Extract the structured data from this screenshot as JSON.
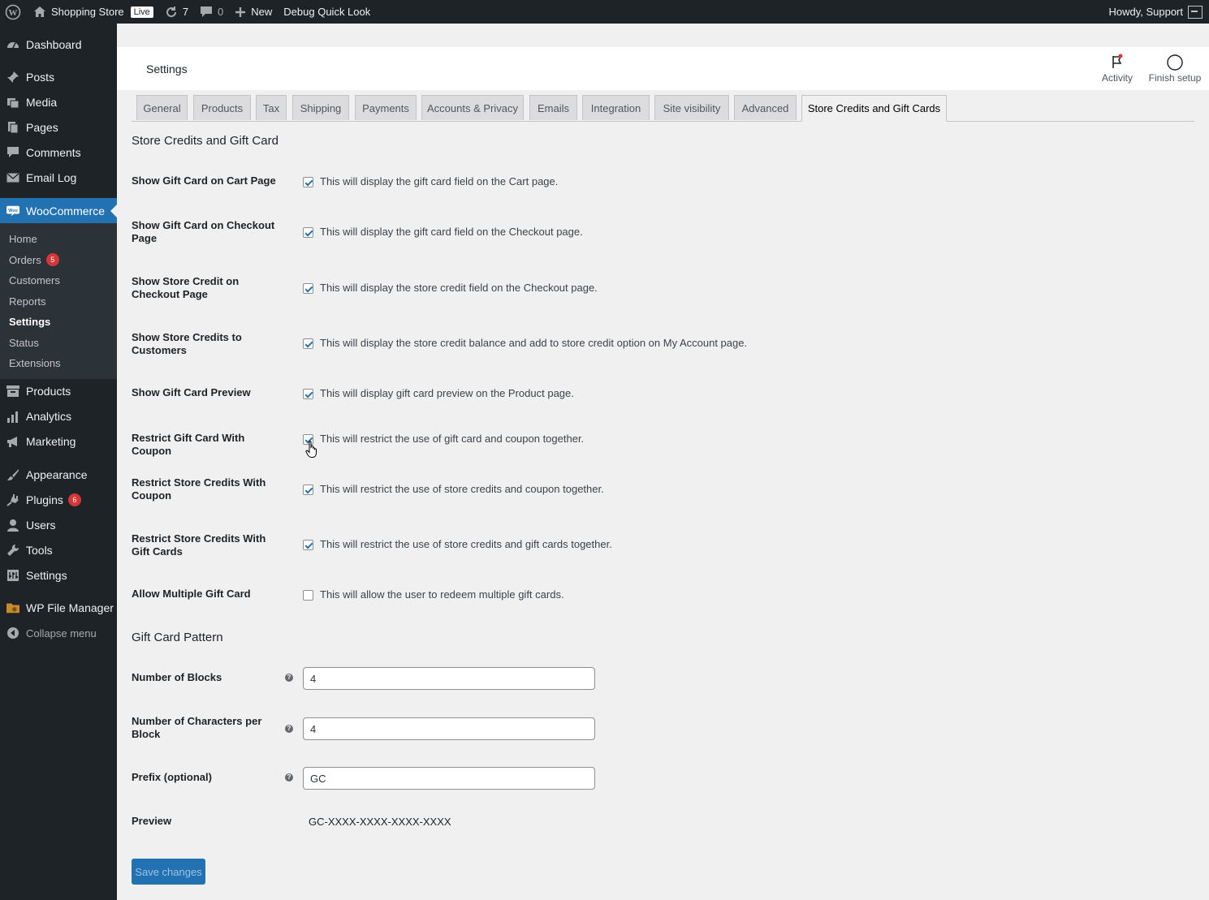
{
  "adminbar": {
    "site_name": "Shopping Store",
    "live_badge": "Live",
    "updates_count": "7",
    "comments_count": "0",
    "new_label": "New",
    "debug_label": "Debug Quick Look",
    "greeting": "Howdy, Support"
  },
  "sidebar": {
    "dashboard": "Dashboard",
    "posts": "Posts",
    "media": "Media",
    "pages": "Pages",
    "comments": "Comments",
    "email_log": "Email Log",
    "woocommerce": "WooCommerce",
    "sub": {
      "home": "Home",
      "orders": "Orders",
      "orders_count": "5",
      "customers": "Customers",
      "reports": "Reports",
      "settings": "Settings",
      "status": "Status",
      "extensions": "Extensions"
    },
    "products": "Products",
    "analytics": "Analytics",
    "marketing": "Marketing",
    "appearance": "Appearance",
    "plugins": "Plugins",
    "plugins_count": "6",
    "users": "Users",
    "tools": "Tools",
    "settings": "Settings",
    "wp_file_manager": "WP File Manager",
    "collapse": "Collapse menu"
  },
  "header": {
    "title": "Settings",
    "activity": "Activity",
    "finish_setup": "Finish setup"
  },
  "tabs": {
    "general": "General",
    "products": "Products",
    "tax": "Tax",
    "shipping": "Shipping",
    "payments": "Payments",
    "accounts": "Accounts & Privacy",
    "emails": "Emails",
    "integration": "Integration",
    "site_visibility": "Site visibility",
    "advanced": "Advanced",
    "store_credits": "Store Credits and Gift Cards"
  },
  "section1": {
    "title": "Store Credits and Gift Card",
    "rows": [
      {
        "label": "Show Gift Card on Cart Page",
        "desc": "This will display the gift card field on the Cart page.",
        "checked": true
      },
      {
        "label": "Show Gift Card on Checkout Page",
        "desc": "This will display the gift card field on the Checkout page.",
        "checked": true
      },
      {
        "label": "Show Store Credit on Checkout Page",
        "desc": "This will display the store credit field on the Checkout page.",
        "checked": true
      },
      {
        "label": "Show Store Credits to Customers",
        "desc": "This will display the store credit balance and add to store credit option on My Account page.",
        "checked": true
      },
      {
        "label": "Show Gift Card Preview",
        "desc": "This will display gift card preview on the Product page.",
        "checked": true
      },
      {
        "label": "Restrict Gift Card With Coupon",
        "desc": "This will restrict the use of gift card and coupon together.",
        "checked": true
      },
      {
        "label": "Restrict Store Credits With Coupon",
        "desc": "This will restrict the use of store credits and coupon together.",
        "checked": true
      },
      {
        "label": "Restrict Store Credits With Gift Cards",
        "desc": "This will restrict the use of store credits and gift cards together.",
        "checked": true
      },
      {
        "label": "Allow Multiple Gift Card",
        "desc": "This will allow the user to redeem multiple gift cards.",
        "checked": false
      }
    ]
  },
  "section2": {
    "title": "Gift Card Pattern",
    "blocks_label": "Number of Blocks",
    "blocks_value": "4",
    "chars_label": "Number of Characters per Block",
    "chars_value": "4",
    "prefix_label": "Prefix (optional)",
    "prefix_value": "GC",
    "help_glyph": "?",
    "preview_label": "Preview",
    "preview_value": "GC-XXXX-XXXX-XXXX-XXXX"
  },
  "save_label": "Save changes",
  "colors": {
    "accent": "#2271b1",
    "adminbar_bg": "#1d2327",
    "badge_red": "#d63638"
  }
}
